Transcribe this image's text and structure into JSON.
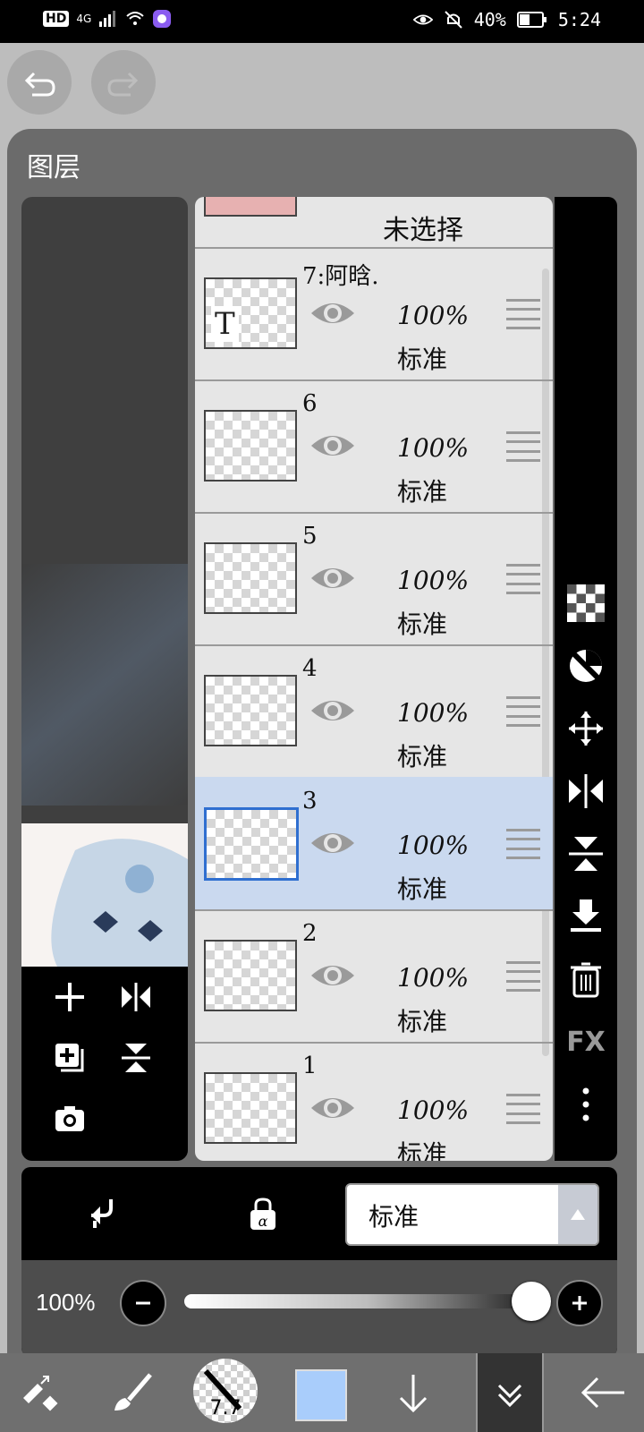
{
  "status_bar": {
    "network_badge": "HD",
    "network_type": "4G",
    "battery": "40%",
    "time": "5:24"
  },
  "panel": {
    "title": "图层"
  },
  "layers_header": {
    "unselected_label": "未选择"
  },
  "layers": [
    {
      "name": "7:阿晗.",
      "opacity": "100%",
      "blend": "标准",
      "selected": false,
      "thumb_text": "T"
    },
    {
      "name": "6",
      "opacity": "100%",
      "blend": "标准",
      "selected": false
    },
    {
      "name": "5",
      "opacity": "100%",
      "blend": "标准",
      "selected": false
    },
    {
      "name": "4",
      "opacity": "100%",
      "blend": "标准",
      "selected": false
    },
    {
      "name": "3",
      "opacity": "100%",
      "blend": "标准",
      "selected": true
    },
    {
      "name": "2",
      "opacity": "100%",
      "blend": "标准",
      "selected": false
    },
    {
      "name": "1",
      "opacity": "100%",
      "blend": "标准",
      "selected": false
    }
  ],
  "side_tools": {
    "fx_label": "FX"
  },
  "blend_mode": {
    "value": "标准"
  },
  "opacity": {
    "label": "100%",
    "level": 1.0
  },
  "toolbar": {
    "brush_size": "7.7",
    "color": "#a9cdfb"
  },
  "icons": [
    "undo-icon",
    "redo-icon",
    "add-icon",
    "flip-horizontal-icon",
    "duplicate-icon",
    "flip-vertical-icon",
    "camera-icon",
    "eye-icon",
    "drag-handle-icon",
    "checker-icon",
    "mask-icon",
    "move-icon",
    "download-icon",
    "trash-icon",
    "more-icon",
    "clip-icon",
    "alpha-lock-icon",
    "chevron-up-icon",
    "minus-icon",
    "plus-icon",
    "transform-icon",
    "brush-icon",
    "arrow-down-icon",
    "chevron-double-down-icon",
    "back-arrow-icon"
  ]
}
